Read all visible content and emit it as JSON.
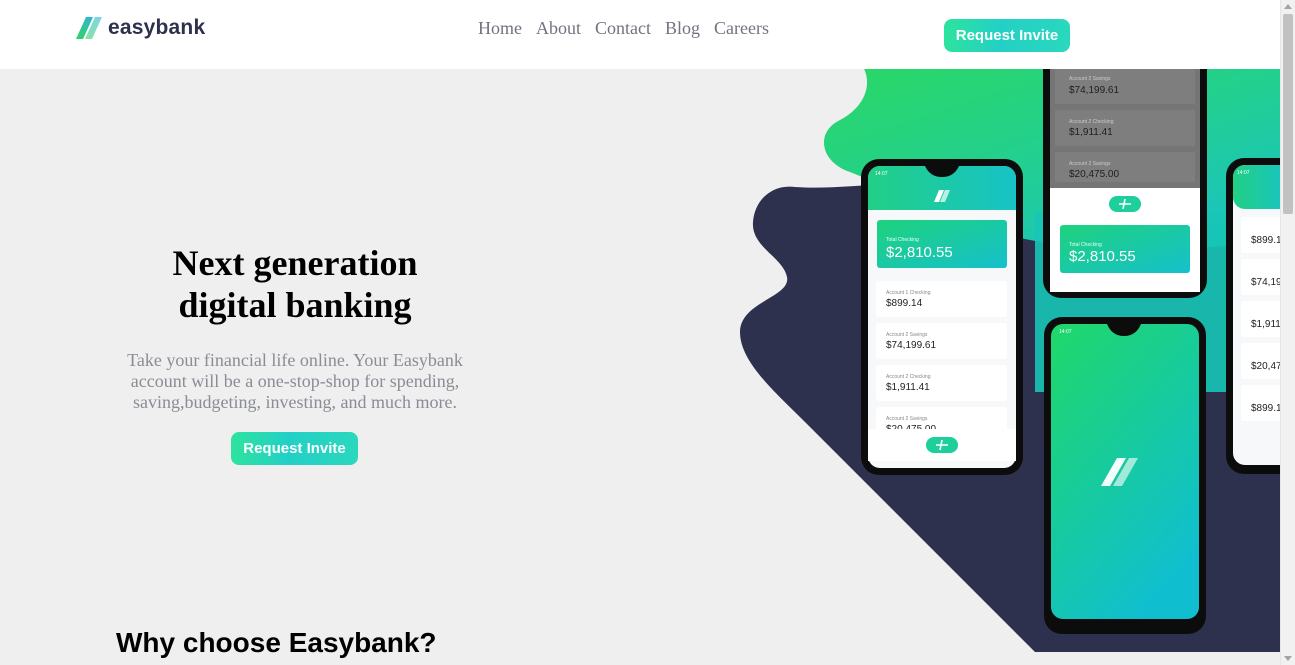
{
  "header": {
    "brand": "easybank",
    "nav": [
      "Home",
      "About",
      "Contact",
      "Blog",
      "Careers"
    ],
    "cta": "Request Invite"
  },
  "hero": {
    "title_line1": "Next generation",
    "title_line2": "digital banking",
    "description": "Take your financial life online. Your Easybank account will be a one-stop-shop for spending, saving,budgeting, investing, and much more.",
    "cta": "Request Invite"
  },
  "phones": {
    "status_time": "14:07",
    "total_checking_label": "Total Checking",
    "total_checking_value": "$2,810.55",
    "accounts": [
      {
        "label": "Account 1 Checking",
        "value": "$899.14"
      },
      {
        "label": "Account 2 Savings",
        "value": "$74,199.61"
      },
      {
        "label": "Account 2 Checking",
        "value": "$1,911.41"
      },
      {
        "label": "Account 2 Savings",
        "value": "$20,475.00"
      }
    ],
    "right_partial_values": [
      "$899.1",
      "$74,19",
      "$1,911.",
      "$20,47",
      "$899.1"
    ]
  },
  "section": {
    "title": "Why choose Easybank?"
  },
  "colors": {
    "dark_navy": "#2d314d",
    "lime_green": "#31d35c",
    "bright_cyan": "#2bb7da",
    "page_bg": "#efefef"
  }
}
